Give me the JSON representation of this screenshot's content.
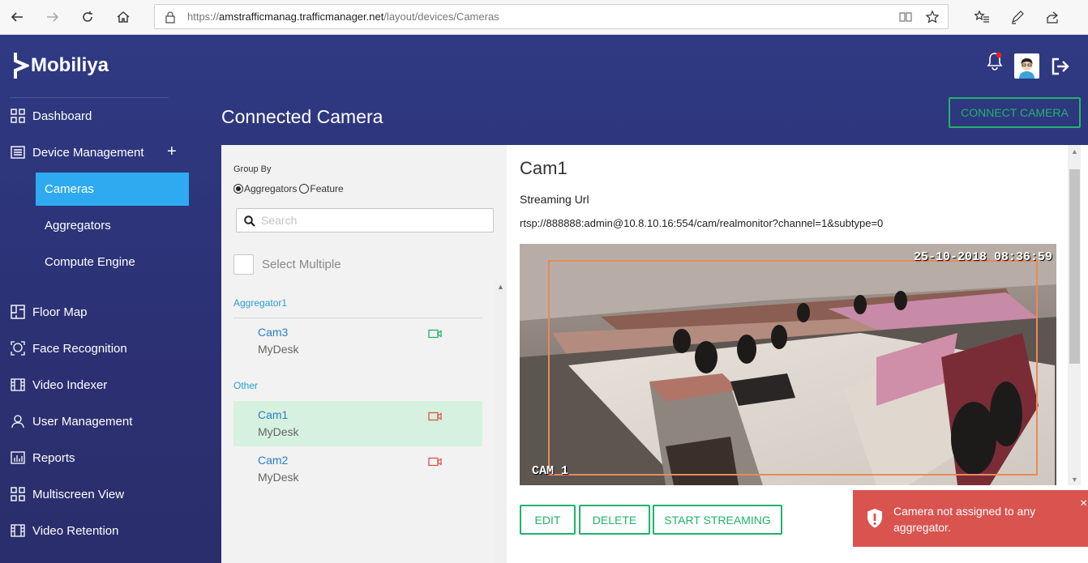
{
  "browser": {
    "url_prefix": "https://",
    "url_host": "amstrafficmanag.trafficmanager.net",
    "url_path": "/layout/devices/Cameras"
  },
  "app": {
    "brand": "Mobiliya"
  },
  "sidebar": {
    "items": [
      {
        "label": "Dashboard",
        "icon": "grid-icon"
      },
      {
        "label": "Device Management",
        "icon": "list-icon"
      },
      {
        "label": "Floor Map",
        "icon": "floor-map-icon"
      },
      {
        "label": "Face Recognition",
        "icon": "face-scan-icon"
      },
      {
        "label": "Video Indexer",
        "icon": "film-icon"
      },
      {
        "label": "User Management",
        "icon": "user-icon"
      },
      {
        "label": "Reports",
        "icon": "bar-chart-icon"
      },
      {
        "label": "Multiscreen View",
        "icon": "grid-icon"
      },
      {
        "label": "Video Retention",
        "icon": "film-icon"
      }
    ],
    "sub_items": [
      {
        "label": "Cameras",
        "active": true
      },
      {
        "label": "Aggregators",
        "active": false
      },
      {
        "label": "Compute Engine",
        "active": false
      }
    ],
    "expand_label": "+"
  },
  "page": {
    "title": "Connected Camera",
    "connect_button": "CONNECT CAMERA"
  },
  "filters": {
    "group_by_label": "Group By",
    "option_aggregators": "Aggregators",
    "option_feature": "Feature",
    "selected": "Aggregators",
    "search_placeholder": "Search",
    "select_multiple_label": "Select Multiple"
  },
  "groups": [
    {
      "name": "Aggregator1",
      "cameras": [
        {
          "name": "Cam3",
          "location": "MyDesk",
          "status_color": "#21b36b"
        }
      ]
    },
    {
      "name": "Other",
      "cameras": [
        {
          "name": "Cam1",
          "location": "MyDesk",
          "status_color": "#d9534f",
          "selected": true
        },
        {
          "name": "Cam2",
          "location": "MyDesk",
          "status_color": "#d9534f"
        }
      ]
    }
  ],
  "detail": {
    "camera_name": "Cam1",
    "streaming_label": "Streaming Url",
    "streaming_url": "rtsp://888888:admin@10.8.10.16:554/cam/realmonitor?channel=1&subtype=0",
    "video_timestamp": "25-10-2018 08:36:59",
    "video_label": "CAM 1",
    "buttons": {
      "edit": "EDIT",
      "delete": "DELETE",
      "start": "START STREAMING"
    }
  },
  "toast": {
    "message": "Camera not assigned to any aggregator.",
    "close": "×"
  },
  "colors": {
    "accent_green": "#21b36b",
    "active_blue": "#2eaaf0",
    "sidebar_bg": "#2e3578",
    "error_red": "#d9534f"
  }
}
